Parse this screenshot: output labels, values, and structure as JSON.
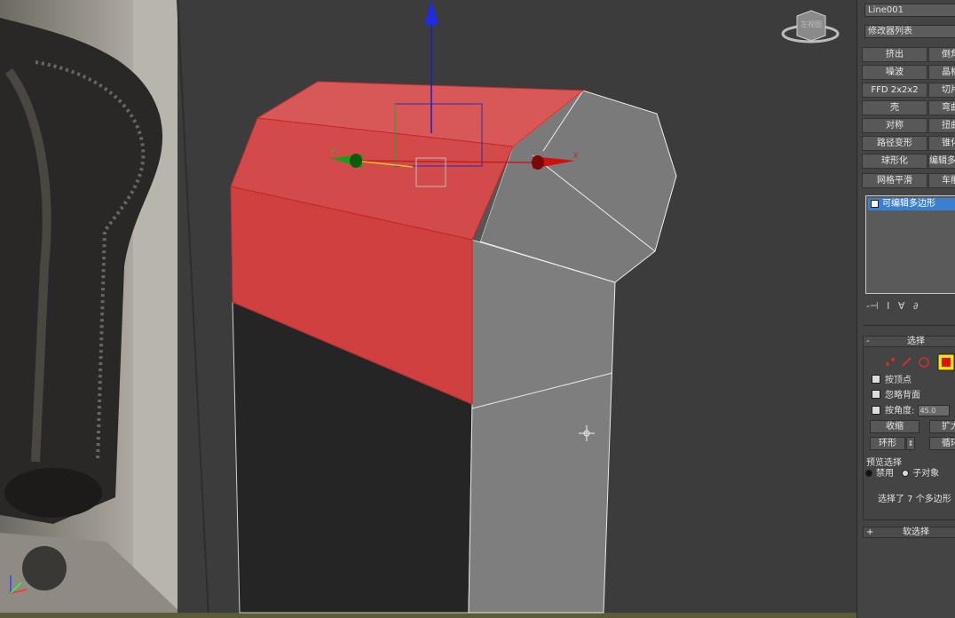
{
  "viewport": {
    "viewcube_label": "左视图",
    "gizmo_axis_x": "X",
    "gizmo_axis_y": "Y",
    "selection_color": "#e04848"
  },
  "panel": {
    "object_name": "Line001",
    "modifier_list_label": "修改器列表",
    "modifier_buttons": [
      "挤出",
      "倒角",
      "噪波",
      "晶格",
      "FFD 2x2x2",
      "切片",
      "壳",
      "弯曲",
      "对称",
      "扭曲",
      "路径变形",
      "锥化",
      "球形化",
      "编辑多边形",
      "网格平滑",
      "车削"
    ],
    "stack_item": "可编辑多边形",
    "stack_tools": [
      "-⊣",
      "I",
      "∀",
      "∂"
    ]
  },
  "selection_rollout": {
    "sign": "-",
    "title": "选择",
    "subobject_icons": [
      "vertex-icon",
      "edge-icon",
      "border-icon",
      "polygon-icon"
    ],
    "by_vertex": "按顶点",
    "ignore_backfacing": "忽略背面",
    "by_angle": "按角度:",
    "angle_value": "45.0",
    "shrink": "收缩",
    "grow": "扩大",
    "ring": "环形",
    "loop": "循环",
    "preview_selection": "预览选择",
    "preview_off": "禁用",
    "preview_subobject": "子对象",
    "status": "选择了 7 个多边形"
  },
  "soft_selection_rollout": {
    "sign": "+",
    "title": "软选择"
  }
}
